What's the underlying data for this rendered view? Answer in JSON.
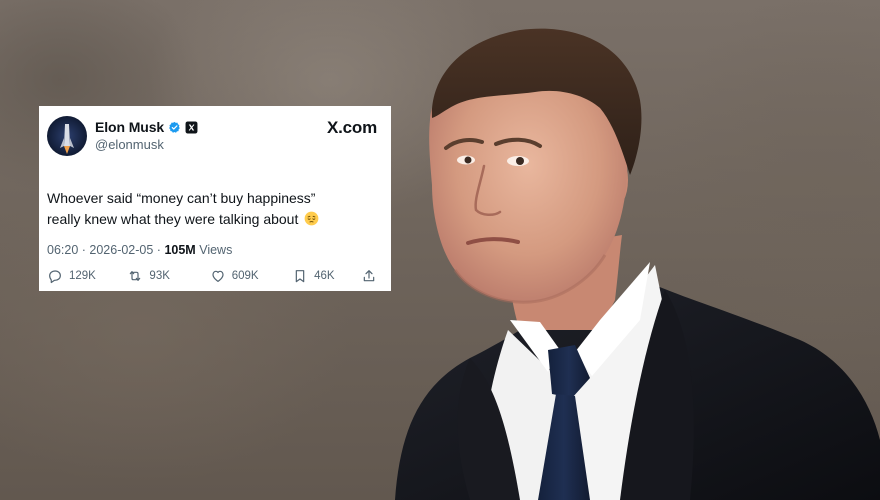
{
  "tweet": {
    "author_name": "Elon Musk",
    "handle": "@elonmusk",
    "site": "X.com",
    "text_line1": "Whoever said “money can’t buy happiness”",
    "text_line2": "really knew what they were talking about",
    "emoji": "pensive-face",
    "timestamp": "06:20 · 2026-02-05 · ",
    "views_count": "105M",
    "views_label": " Views",
    "stats": {
      "replies": "129K",
      "reposts": "93K",
      "likes": "609K",
      "bookmarks": "46K"
    },
    "colors": {
      "verified": "#1d9bf0",
      "text": "#0f1419",
      "muted": "#536471"
    }
  },
  "photo": {
    "subject": "man-in-dark-suit-and-navy-tie"
  }
}
